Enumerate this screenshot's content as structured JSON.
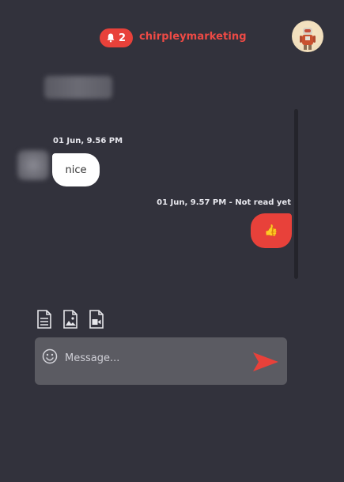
{
  "header": {
    "notification_count": "2",
    "username": "chirpleymarketing",
    "bell_icon": "bell-icon",
    "avatar_icon": "robot-avatar"
  },
  "chat": {
    "messages": [
      {
        "direction": "incoming",
        "timestamp": "01 Jun, 9.56 PM",
        "text": "nice"
      },
      {
        "direction": "outgoing",
        "timestamp": "01 Jun, 9.57 PM - Not read yet",
        "text": "👍"
      }
    ]
  },
  "composer": {
    "placeholder": "Message...",
    "attach_icons": [
      "document-icon",
      "image-icon",
      "video-icon"
    ],
    "emoji_icon": "smiley-icon",
    "send_icon": "send-arrow-icon"
  },
  "colors": {
    "background": "#32323c",
    "accent": "#e8413a",
    "composer": "#5b5b62",
    "incoming_bubble": "#ffffff"
  }
}
